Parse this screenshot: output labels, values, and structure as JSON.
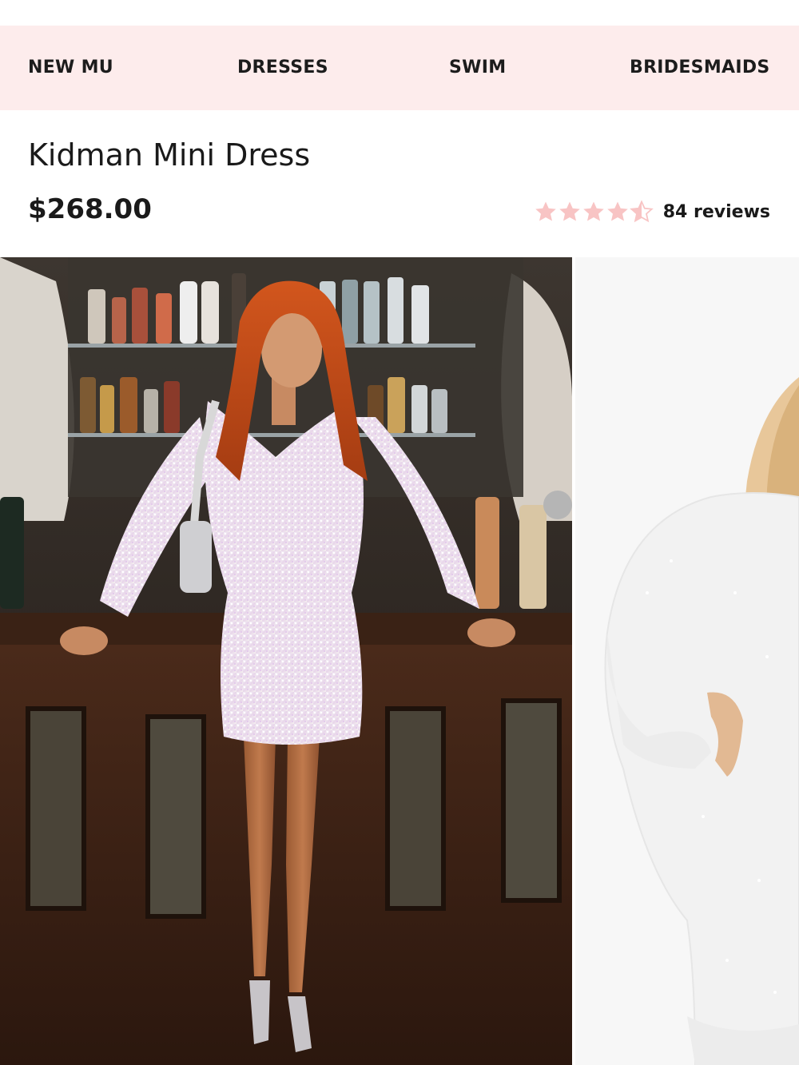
{
  "nav": {
    "items": [
      {
        "label": "NEW MU"
      },
      {
        "label": "DRESSES"
      },
      {
        "label": "SWIM"
      },
      {
        "label": "BRIDESMAIDS"
      }
    ]
  },
  "product": {
    "title": "Kidman Mini Dress",
    "price": "$268.00",
    "rating": {
      "value": 4.5,
      "max": 5,
      "reviews_label": "84 reviews"
    }
  },
  "colors": {
    "nav_background": "#fdecec",
    "star_color": "#f8c4c4",
    "text": "#1a1a1a"
  },
  "gallery": {
    "images": [
      {
        "name": "model-at-bar-photo"
      },
      {
        "name": "studio-model-photo"
      }
    ]
  }
}
